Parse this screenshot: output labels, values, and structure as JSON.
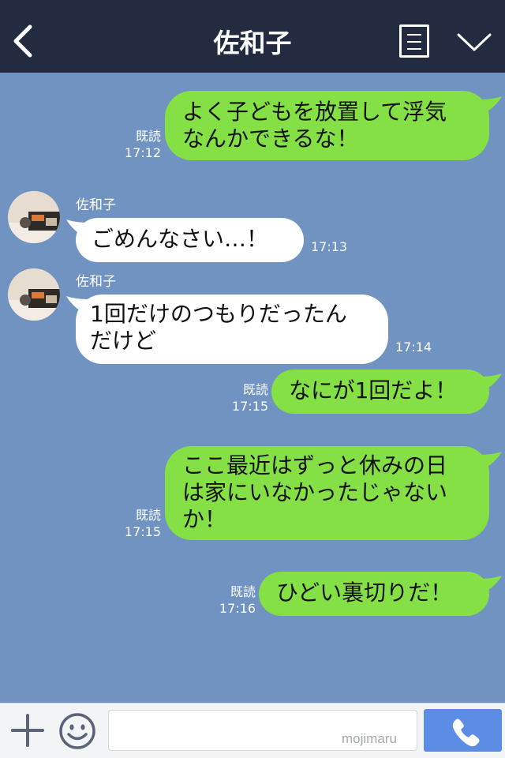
{
  "header": {
    "title": "佐和子"
  },
  "messages": [
    {
      "from": "me",
      "lines": [
        "よく子どもを放置して浮気",
        "なんかできるな！"
      ],
      "read": "既読",
      "time": "17:12"
    },
    {
      "from": "other",
      "sender": "佐和子",
      "lines": [
        "ごめんなさい…！"
      ],
      "time": "17:13"
    },
    {
      "from": "other",
      "sender": "佐和子",
      "lines": [
        "1回だけのつもりだったん",
        "だけど"
      ],
      "time": "17:14"
    },
    {
      "from": "me",
      "lines": [
        "なにが1回だよ！"
      ],
      "read": "既読",
      "time": "17:15"
    },
    {
      "from": "me",
      "lines": [
        "ここ最近はずっと休みの日",
        "は家にいなかったじゃない",
        "か！"
      ],
      "read": "既読",
      "time": "17:15"
    },
    {
      "from": "me",
      "lines": [
        "ひどい裏切りだ！"
      ],
      "read": "既読",
      "time": "17:16"
    }
  ],
  "input": {
    "value": "",
    "watermark": "mojimaru"
  },
  "colors": {
    "header_bg": "#232b40",
    "chat_bg": "#7093c1",
    "my_bubble": "#84e044",
    "their_bubble": "#ffffff",
    "call_button": "#5b8de4"
  },
  "icons": [
    "back-arrow-icon",
    "menu-list-icon",
    "chevron-down-icon",
    "plus-icon",
    "smile-icon",
    "phone-icon"
  ]
}
